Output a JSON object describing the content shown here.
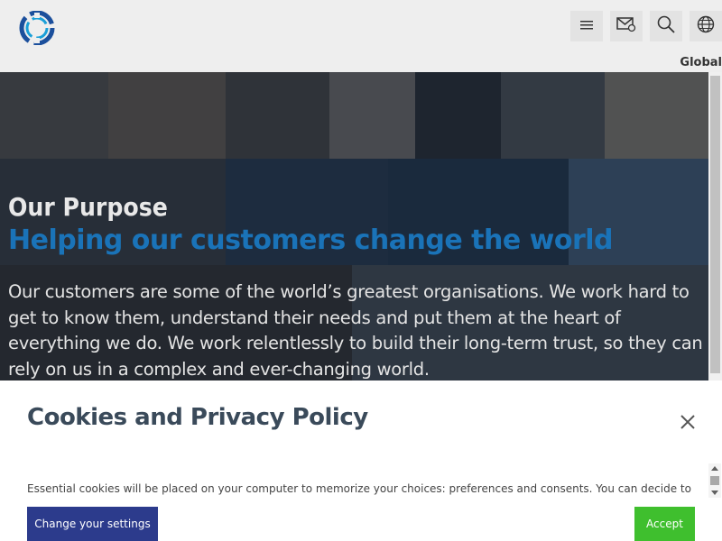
{
  "header": {
    "region": "Global",
    "icons": [
      "menu-icon",
      "mail-icon",
      "search-icon",
      "globe-icon"
    ]
  },
  "hero": {
    "kicker": "Our Purpose",
    "title": "Helping our customers change the world",
    "body": "Our customers are some of the world’s greatest organisations. We work hard to get to know them, understand their needs and put them at the heart of everything we do. We work relentlessly to build their long-term trust, so they can rely on us in a complex and ever-changing world."
  },
  "cookie": {
    "title": "Cookies and Privacy Policy",
    "text": "Essential cookies will be placed on your computer to memorize your choices: preferences and consents. You can decide to disable",
    "settings_label": "Change your settings",
    "accept_label": "Accept"
  },
  "colors": {
    "brand_blue": "#1a73b8",
    "settings_button": "#2c3b8c",
    "accept_button": "#3fbf2e"
  }
}
